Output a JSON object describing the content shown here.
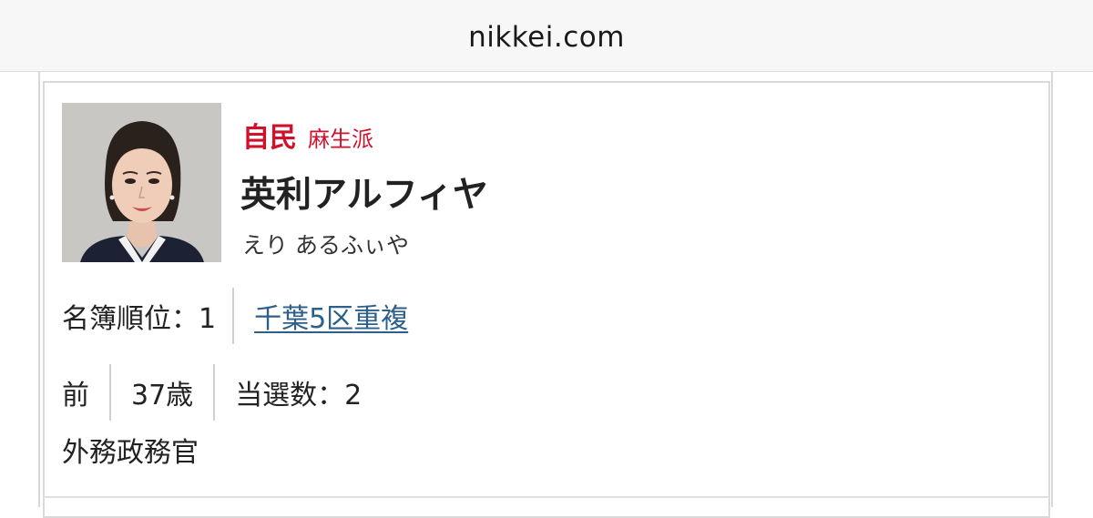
{
  "browser": {
    "url": "nikkei.com"
  },
  "candidate": {
    "party": "自民",
    "faction": "麻生派",
    "name": "英利アルフィヤ",
    "kana": "えり あるふぃや",
    "rank_text": "名簿順位：1",
    "district_link": "千葉5区重複",
    "status": "前",
    "age": "37歳",
    "wins": "当選数：2",
    "post": "外務政務官"
  },
  "colors": {
    "party_red": "#d0112b",
    "link_blue": "#2c5f8a"
  }
}
